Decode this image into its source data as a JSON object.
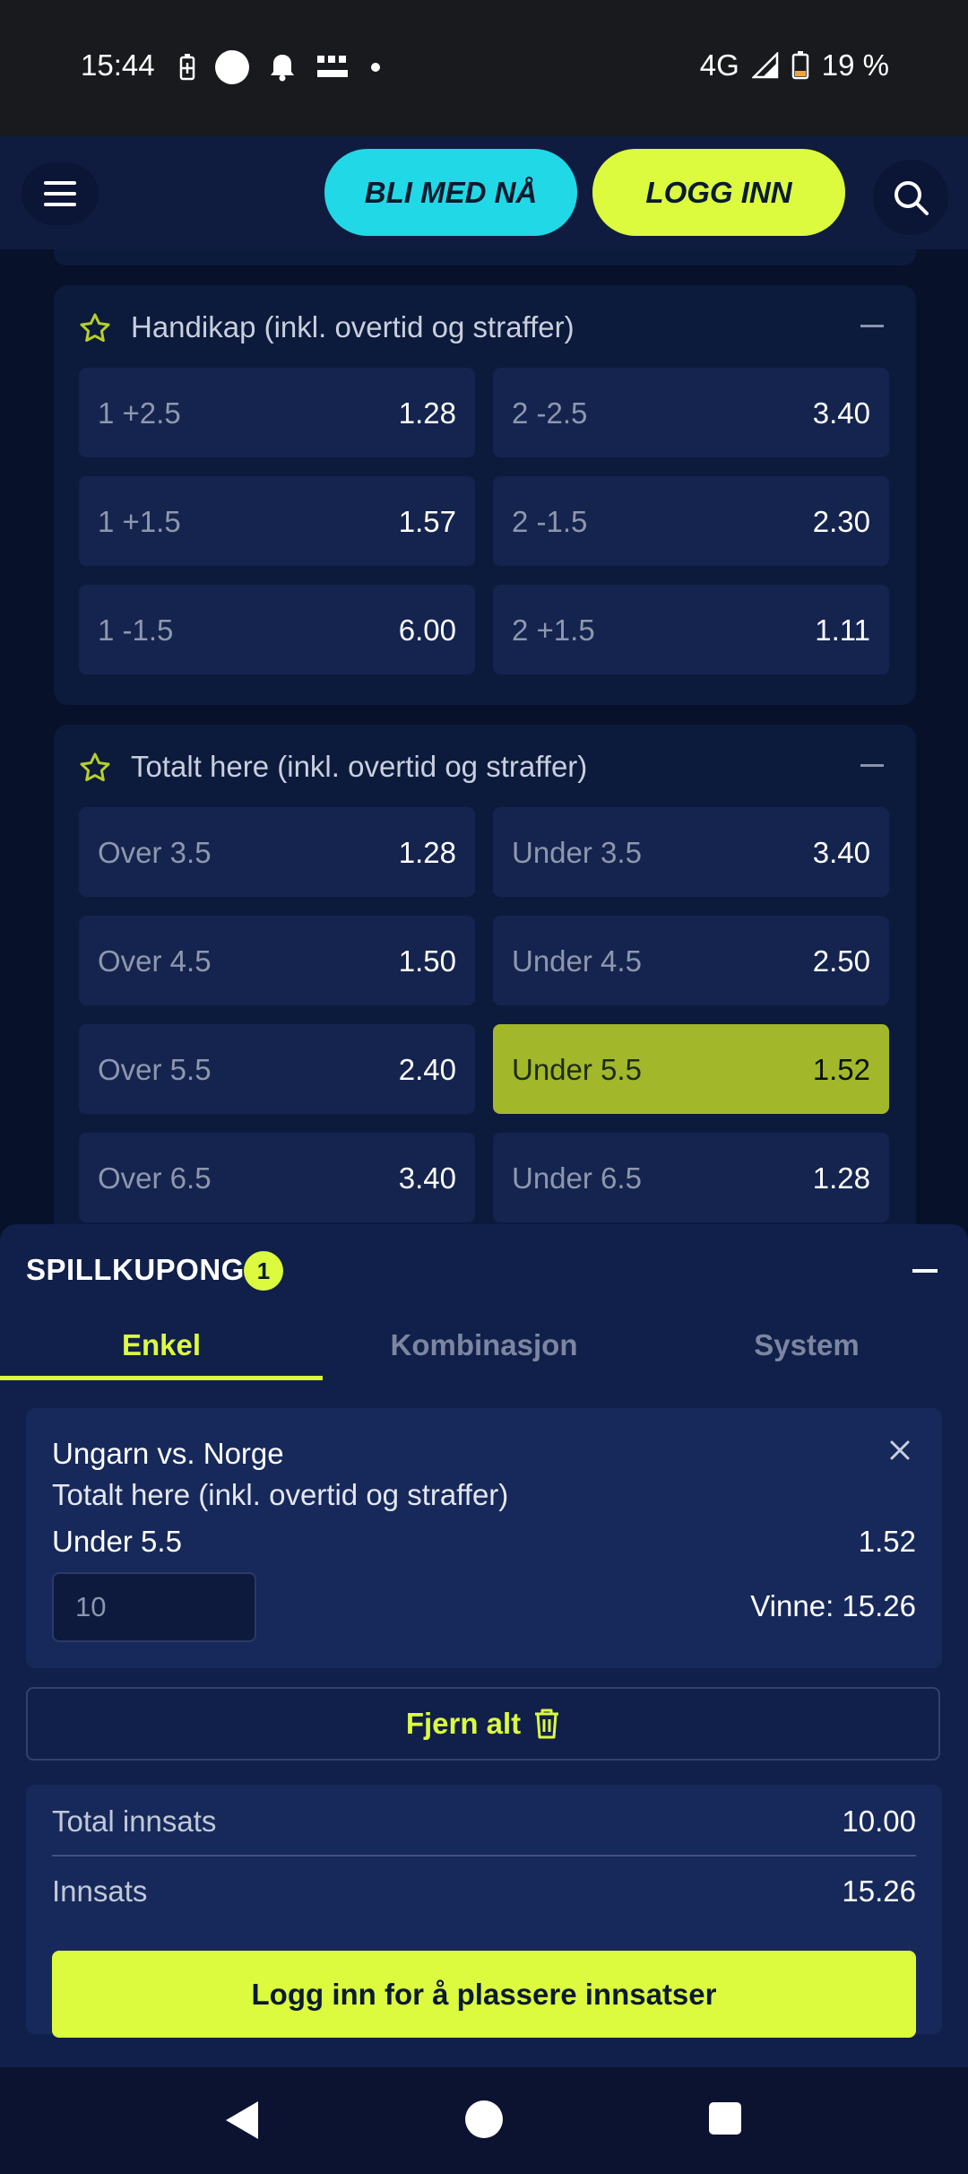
{
  "status_bar": {
    "time": "15:44",
    "network": "4G",
    "battery": "19 %",
    "icons": [
      "battery-saver-icon",
      "circle-icon",
      "notification-bell-icon",
      "temu-icon",
      "dot-icon",
      "signal-icon",
      "battery-icon"
    ]
  },
  "header": {
    "join_label": "BLI MED NÅ",
    "login_label": "LOGG INN"
  },
  "markets": [
    {
      "title": "Handikap (inkl. overtid og straffer)",
      "odds": [
        {
          "label": "1 +2.5",
          "price": "1.28"
        },
        {
          "label": "2 -2.5",
          "price": "3.40"
        },
        {
          "label": "1 +1.5",
          "price": "1.57"
        },
        {
          "label": "2 -1.5",
          "price": "2.30"
        },
        {
          "label": "1 -1.5",
          "price": "6.00"
        },
        {
          "label": "2 +1.5",
          "price": "1.11"
        }
      ]
    },
    {
      "title": "Totalt here (inkl. overtid og straffer)",
      "odds": [
        {
          "label": "Over 3.5",
          "price": "1.28"
        },
        {
          "label": "Under 3.5",
          "price": "3.40"
        },
        {
          "label": "Over 4.5",
          "price": "1.50"
        },
        {
          "label": "Under 4.5",
          "price": "2.50"
        },
        {
          "label": "Over 5.5",
          "price": "2.40"
        },
        {
          "label": "Under 5.5",
          "price": "1.52",
          "selected": true
        },
        {
          "label": "Over 6.5",
          "price": "3.40"
        },
        {
          "label": "Under 6.5",
          "price": "1.28"
        }
      ]
    }
  ],
  "betslip": {
    "title": "SPILLKUPONG",
    "count": "1",
    "tabs": [
      "Enkel",
      "Kombinasjon",
      "System"
    ],
    "active_tab": "Enkel",
    "bet": {
      "match": "Ungarn vs. Norge",
      "market": "Totalt here (inkl. overtid og straffer)",
      "selection": "Under 5.5",
      "odds": "1.52",
      "stake": "10",
      "win_text": "Vinne: 15.26"
    },
    "remove_all_label": "Fjern alt",
    "total_stake_label": "Total innsats",
    "total_stake_value": "10.00",
    "stake_label": "Innsats",
    "stake_value": "15.26",
    "place_label": "Logg inn for å plassere innsatser"
  },
  "colors": {
    "accent_lime": "#dcfb3f",
    "accent_cyan": "#21d8e6",
    "selected_odd": "#a2b82a",
    "background": "#08112a"
  }
}
